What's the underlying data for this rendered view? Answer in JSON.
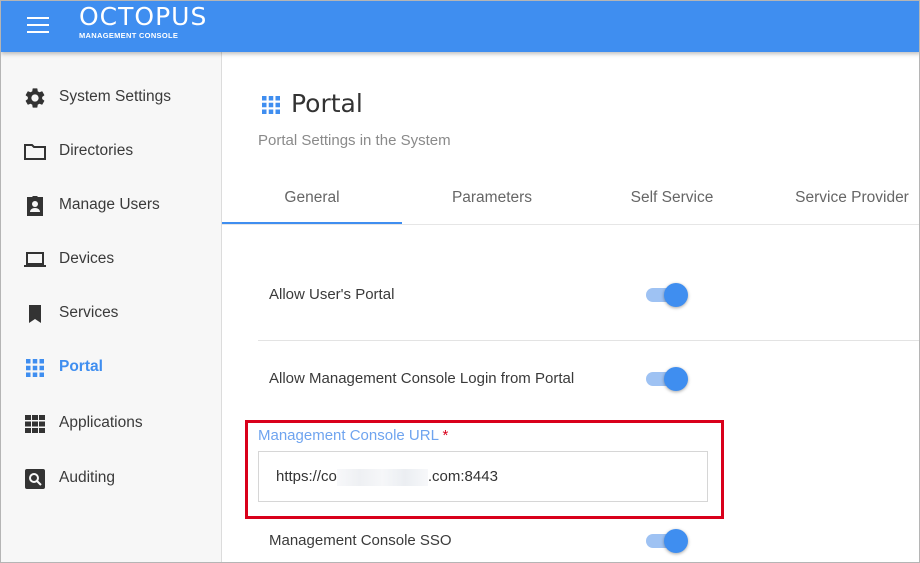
{
  "header": {
    "logo_main": "OCTOPUS",
    "logo_sub": "MANAGEMENT CONSOLE",
    "brand_color": "#3f8ef0"
  },
  "sidebar": {
    "items": [
      {
        "label": "System Settings",
        "icon": "gear-icon",
        "active": false
      },
      {
        "label": "Directories",
        "icon": "folder-icon",
        "active": false
      },
      {
        "label": "Manage Users",
        "icon": "user-badge-icon",
        "active": false
      },
      {
        "label": "Devices",
        "icon": "laptop-icon",
        "active": false
      },
      {
        "label": "Services",
        "icon": "bookmark-icon",
        "active": false
      },
      {
        "label": "Portal",
        "icon": "grid-dots-icon",
        "active": true
      },
      {
        "label": "Applications",
        "icon": "apps-grid-icon",
        "active": false
      },
      {
        "label": "Auditing",
        "icon": "search-box-icon",
        "active": false
      }
    ]
  },
  "main": {
    "title": "Portal",
    "subtitle": "Portal Settings in the System",
    "tabs": [
      {
        "label": "General",
        "active": true
      },
      {
        "label": "Parameters",
        "active": false
      },
      {
        "label": "Self Service",
        "active": false
      },
      {
        "label": "Service Provider",
        "active": false
      }
    ],
    "settings": [
      {
        "label": "Allow User's Portal",
        "enabled": true
      },
      {
        "label": "Allow Management Console Login from Portal",
        "enabled": true
      },
      {
        "label": "Management Console SSO",
        "enabled": true
      }
    ],
    "url_field": {
      "label": "Management Console URL",
      "required_mark": "*",
      "value_prefix": "https://co",
      "value_suffix": ".com:8443"
    }
  },
  "colors": {
    "accent": "#3f8ef0",
    "highlight": "#d9001b"
  }
}
